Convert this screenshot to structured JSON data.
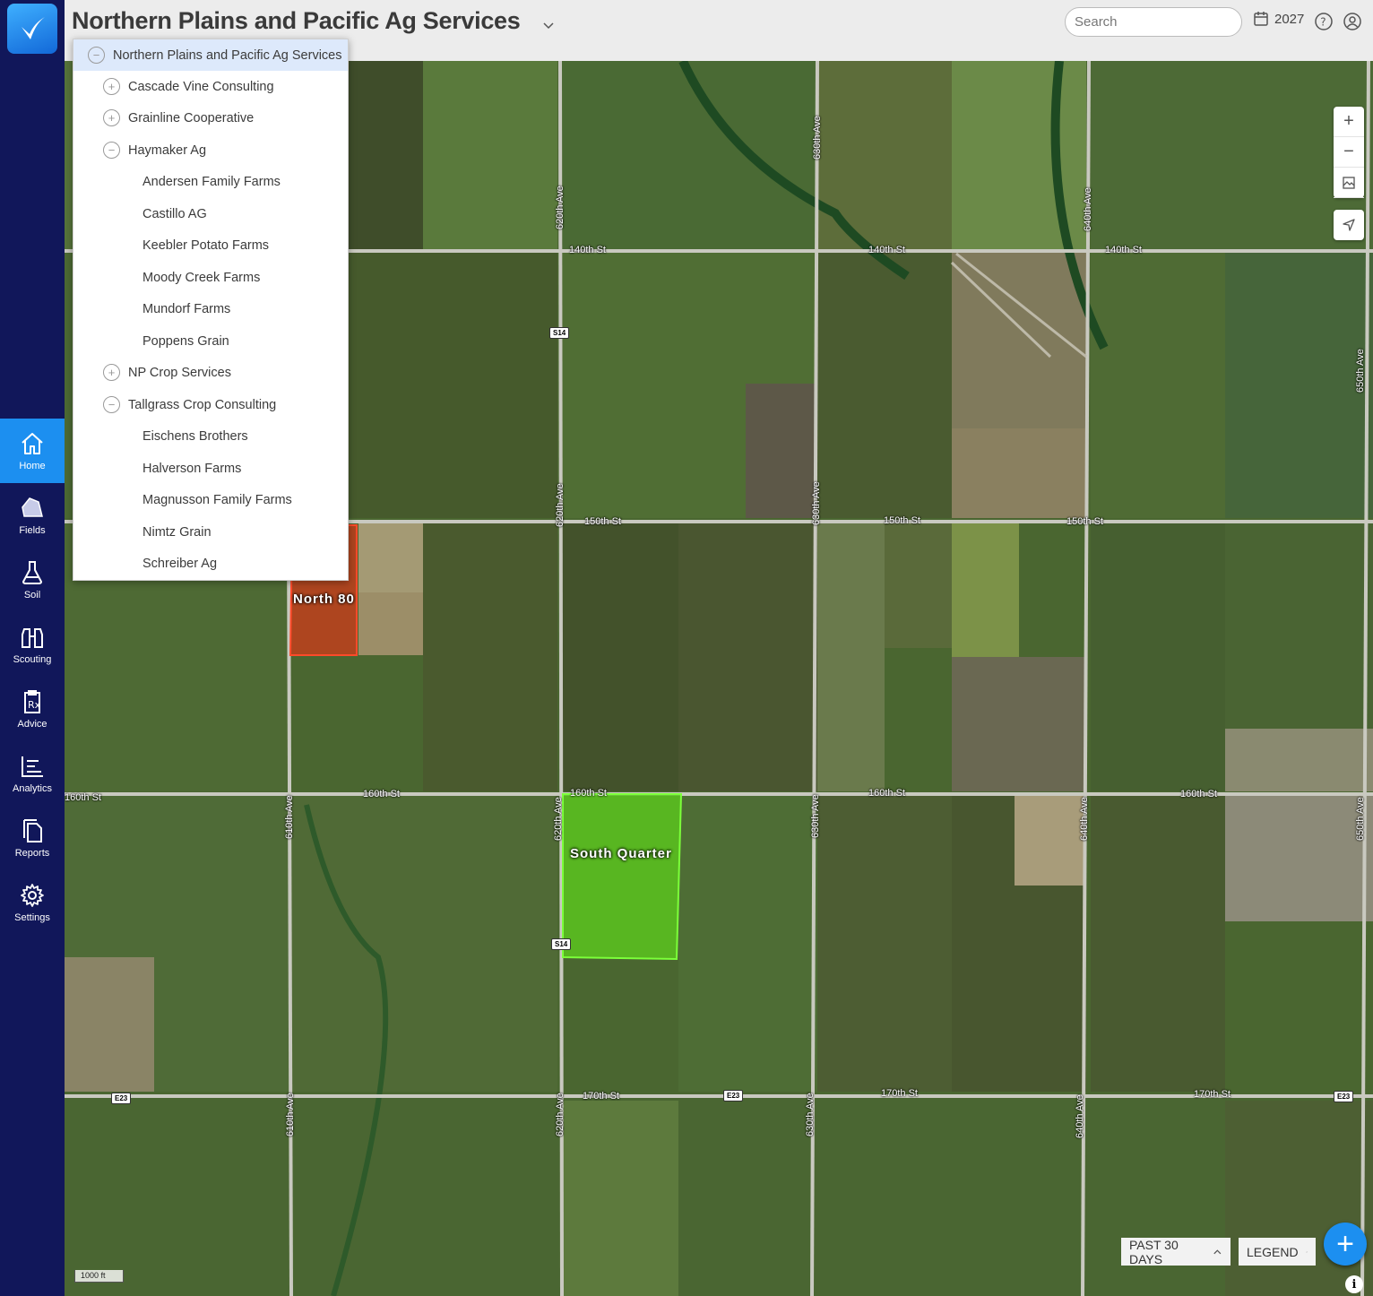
{
  "header": {
    "title": "Northern Plains and Pacific Ag Services",
    "search_placeholder": "Search",
    "year": "2027"
  },
  "sidebar": {
    "items": [
      {
        "label": "Home",
        "icon": "home-icon",
        "active": true
      },
      {
        "label": "Fields",
        "icon": "fields-icon"
      },
      {
        "label": "Soil",
        "icon": "flask-icon"
      },
      {
        "label": "Scouting",
        "icon": "binoculars-icon"
      },
      {
        "label": "Advice",
        "icon": "prescription-icon"
      },
      {
        "label": "Analytics",
        "icon": "analytics-icon"
      },
      {
        "label": "Reports",
        "icon": "reports-icon"
      },
      {
        "label": "Settings",
        "icon": "gear-icon"
      }
    ]
  },
  "org_dropdown": {
    "root": "Northern Plains and Pacific Ag Services",
    "items": [
      {
        "label": "Cascade Vine Consulting",
        "level": 1,
        "toggle": "+"
      },
      {
        "label": "Grainline Cooperative",
        "level": 1,
        "toggle": "+"
      },
      {
        "label": "Haymaker Ag",
        "level": 1,
        "toggle": "−"
      },
      {
        "label": "Andersen Family Farms",
        "level": 2
      },
      {
        "label": "Castillo AG",
        "level": 2
      },
      {
        "label": "Keebler Potato Farms",
        "level": 2
      },
      {
        "label": "Moody Creek Farms",
        "level": 2
      },
      {
        "label": "Mundorf Farms",
        "level": 2
      },
      {
        "label": "Poppens Grain",
        "level": 2
      },
      {
        "label": "NP Crop Services",
        "level": 1,
        "toggle": "+"
      },
      {
        "label": "Tallgrass Crop Consulting",
        "level": 1,
        "toggle": "−"
      },
      {
        "label": "Eischens Brothers",
        "level": 2
      },
      {
        "label": "Halverson Farms",
        "level": 2
      },
      {
        "label": "Magnusson Family Farms",
        "level": 2
      },
      {
        "label": "Nimtz Grain",
        "level": 2
      },
      {
        "label": "Schreiber Ag",
        "level": 2
      }
    ]
  },
  "map": {
    "fields": {
      "north": {
        "label": "North 80",
        "color": "#c0401c"
      },
      "south": {
        "label": "South Quarter",
        "color": "#5bc41f"
      }
    },
    "roads": {
      "st140": "140th St",
      "st150": "150th St",
      "st160": "160th St",
      "st170": "170th St",
      "ave610": "610th Ave",
      "ave620": "620th Ave",
      "ave630": "630th Ave",
      "ave640": "640th Ave",
      "ave650": "650th Ave"
    },
    "shields": {
      "s14": "S14",
      "e23": "E23"
    },
    "scale": "1000 ft"
  },
  "controls": {
    "zoom_in": "+",
    "zoom_out": "−",
    "past_days": "PAST 30 DAYS",
    "legend": "LEGEND",
    "add": "+",
    "info": "i"
  }
}
